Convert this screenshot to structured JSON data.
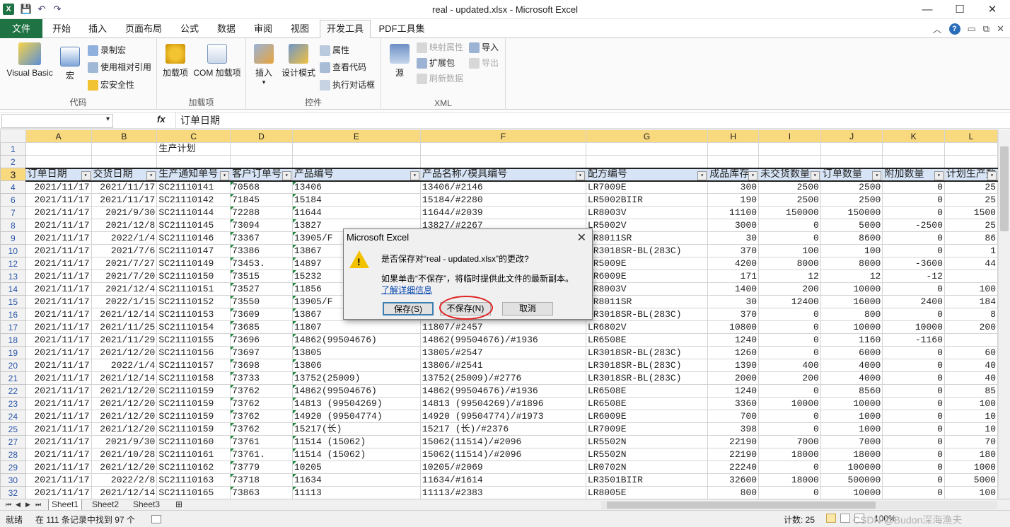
{
  "window": {
    "title": "real - updated.xlsx  -  Microsoft Excel"
  },
  "qat": {
    "save": "💾",
    "undo": "↶",
    "redo": "↷"
  },
  "tabs": [
    "文件",
    "开始",
    "插入",
    "页面布局",
    "公式",
    "数据",
    "审阅",
    "视图",
    "开发工具",
    "PDF工具集"
  ],
  "ribbon": {
    "code": {
      "label": "代码",
      "vb": "Visual Basic",
      "macro": "宏",
      "record": "录制宏",
      "relative": "使用相对引用",
      "security": "宏安全性"
    },
    "addins": {
      "label": "加载项",
      "addin": "加载项",
      "com": "COM 加载项"
    },
    "controls": {
      "label": "控件",
      "insert": "插入",
      "design": "设计模式",
      "props": "属性",
      "viewcode": "查看代码",
      "dialog": "执行对话框"
    },
    "xml": {
      "label": "XML",
      "source": "源",
      "map": "映射属性",
      "ext": "扩展包",
      "refresh": "刷新数据",
      "import": "导入",
      "export": "导出"
    }
  },
  "formula": {
    "fx": "fx",
    "value": "订单日期"
  },
  "columns": [
    "A",
    "B",
    "C",
    "D",
    "E",
    "F",
    "G",
    "H",
    "I",
    "J",
    "K",
    "L"
  ],
  "sheet": {
    "r1": {
      "rownum": "1",
      "c": "生产计划"
    },
    "r2": {
      "rownum": "2"
    },
    "header": {
      "rownum": "3",
      "cols": [
        "订单日期",
        "交货日期",
        "生产通知单号",
        "客户订单号",
        "产品编号",
        "产品名称/模具编号",
        "配方编号",
        "成品库存",
        "未交货数量",
        "订单数量",
        "附加数量",
        "计划生产数"
      ]
    },
    "rows": [
      [
        "4",
        "2021/11/17",
        "2021/11/17",
        "SC21110141",
        "70568",
        "13406",
        "13406/#2146",
        "LR7009E",
        "300",
        "2500",
        "2500",
        "0",
        "25"
      ],
      [
        "6",
        "2021/11/17",
        "2021/11/17",
        "SC21110142",
        "71845",
        "15184",
        "15184/#2280",
        "LR5002BIIR",
        "190",
        "2500",
        "2500",
        "0",
        "25"
      ],
      [
        "7",
        "2021/11/17",
        "2021/9/30",
        "SC21110144",
        "72288",
        "11644",
        "11644/#2039",
        "LR8003V",
        "11100",
        "150000",
        "150000",
        "0",
        "1500"
      ],
      [
        "8",
        "2021/11/17",
        "2021/12/8",
        "SC21110145",
        "73094",
        "13827",
        "13827/#2267",
        "LR5002V",
        "3000",
        "0",
        "5000",
        "-2500",
        "25"
      ],
      [
        "9",
        "2021/11/17",
        "2022/1/4",
        "SC21110146",
        "73367",
        "13905/F",
        "",
        "LR8011SR",
        "30",
        "0",
        "8600",
        "0",
        "86"
      ],
      [
        "10",
        "2021/11/17",
        "2021/7/6",
        "SC21110147",
        "73386",
        "13867",
        "",
        "LR3018SR-BL(283C)",
        "370",
        "100",
        "100",
        "0",
        "1"
      ],
      [
        "12",
        "2021/11/17",
        "2021/7/27",
        "SC21110149",
        "73453.",
        "14897",
        "",
        "LR5009E",
        "4200",
        "8000",
        "8000",
        "-3600",
        "44"
      ],
      [
        "13",
        "2021/11/17",
        "2021/7/20",
        "SC21110150",
        "73515",
        "15232",
        "",
        "LR6009E",
        "171",
        "12",
        "12",
        "-12",
        ""
      ],
      [
        "14",
        "2021/11/17",
        "2021/12/4",
        "SC21110151",
        "73527",
        "11856",
        "",
        "LR8003V",
        "1400",
        "200",
        "10000",
        "0",
        "100"
      ],
      [
        "15",
        "2021/11/17",
        "2022/1/15",
        "SC21110152",
        "73550",
        "13905/F",
        "",
        "LR8011SR",
        "30",
        "12400",
        "16000",
        "2400",
        "184"
      ],
      [
        "16",
        "2021/11/17",
        "2021/12/14",
        "SC21110153",
        "73609",
        "13867",
        "",
        "LR3018SR-BL(283C)",
        "370",
        "0",
        "800",
        "0",
        "8"
      ],
      [
        "17",
        "2021/11/17",
        "2021/11/25",
        "SC21110154",
        "73685",
        "11807",
        "11807/#2457",
        "LR6802V",
        "10800",
        "0",
        "10000",
        "10000",
        "200"
      ],
      [
        "18",
        "2021/11/17",
        "2021/11/29",
        "SC21110155",
        "73696",
        "14862(99504676)",
        "14862(99504676)/#1936",
        "LR6508E",
        "1240",
        "0",
        "1160",
        "-1160",
        ""
      ],
      [
        "19",
        "2021/11/17",
        "2021/12/20",
        "SC21110156",
        "73697",
        "13805",
        "13805/#2547",
        "LR3018SR-BL(283C)",
        "1260",
        "0",
        "6000",
        "0",
        "60"
      ],
      [
        "20",
        "2021/11/17",
        "2022/1/4",
        "SC21110157",
        "73698",
        "13806",
        "13806/#2541",
        "LR3018SR-BL(283C)",
        "1390",
        "400",
        "4000",
        "0",
        "40"
      ],
      [
        "21",
        "2021/11/17",
        "2021/12/14",
        "SC21110158",
        "73733",
        "13752(25009)",
        "13752(25009)/#2776",
        "LR3018SR-BL(283C)",
        "2000",
        "200",
        "4000",
        "0",
        "40"
      ],
      [
        "22",
        "2021/11/17",
        "2021/12/20",
        "SC21110159",
        "73762",
        "14862(99504676)",
        "14862(99504676)/#1936",
        "LR6508E",
        "1240",
        "0",
        "8560",
        "0",
        "85"
      ],
      [
        "23",
        "2021/11/17",
        "2021/12/20",
        "SC21110159",
        "73762",
        "14813 (99504269)",
        "14813 (99504269)/#1896",
        "LR6508E",
        "3360",
        "10000",
        "10000",
        "0",
        "100"
      ],
      [
        "24",
        "2021/11/17",
        "2021/12/20",
        "SC21110159",
        "73762",
        "14920 (99504774)",
        "14920 (99504774)/#1973",
        "LR6009E",
        "700",
        "0",
        "1000",
        "0",
        "10"
      ],
      [
        "25",
        "2021/11/17",
        "2021/12/20",
        "SC21110159",
        "73762",
        "15217(长)",
        "15217 (长)/#2376",
        "LR7009E",
        "398",
        "0",
        "1000",
        "0",
        "10"
      ],
      [
        "27",
        "2021/11/17",
        "2021/9/30",
        "SC21110160",
        "73761",
        "11514 (15062)",
        "15062(11514)/#2096",
        "LR5502N",
        "22190",
        "7000",
        "7000",
        "0",
        "70"
      ],
      [
        "28",
        "2021/11/17",
        "2021/10/28",
        "SC21110161",
        "73761.",
        "11514 (15062)",
        "15062(11514)/#2096",
        "LR5502N",
        "22190",
        "18000",
        "18000",
        "0",
        "180"
      ],
      [
        "29",
        "2021/11/17",
        "2021/12/20",
        "SC21110162",
        "73779",
        "10205",
        "10205/#2069",
        "LR0702N",
        "22240",
        "0",
        "100000",
        "0",
        "1000"
      ],
      [
        "30",
        "2021/11/17",
        "2022/2/8",
        "SC21110163",
        "73718",
        "11634",
        "11634/#1614",
        "LR3501BIIR",
        "32600",
        "18000",
        "500000",
        "0",
        "5000"
      ],
      [
        "32",
        "2021/11/17",
        "2021/12/14",
        "SC21110165",
        "73863",
        "11113",
        "11113/#2383",
        "LR8005E",
        "800",
        "0",
        "10000",
        "0",
        "100"
      ]
    ]
  },
  "sheets": [
    "Sheet1",
    "Sheet2",
    "Sheet3"
  ],
  "status": {
    "ready": "就绪",
    "found": "在 111 条记录中找到 97 个",
    "count": "计数: 25",
    "zoom": "100%",
    "watermark": "CSDN @Budon深海渔夫"
  },
  "dialog": {
    "title": "Microsoft Excel",
    "question": "是否保存对“real - updated.xlsx”的更改?",
    "info": "如果单击“不保存”，将临时提供此文件的最新副本。",
    "link": "了解详细信息",
    "save": "保存(S)",
    "dontsave": "不保存(N)",
    "cancel": "取消"
  }
}
